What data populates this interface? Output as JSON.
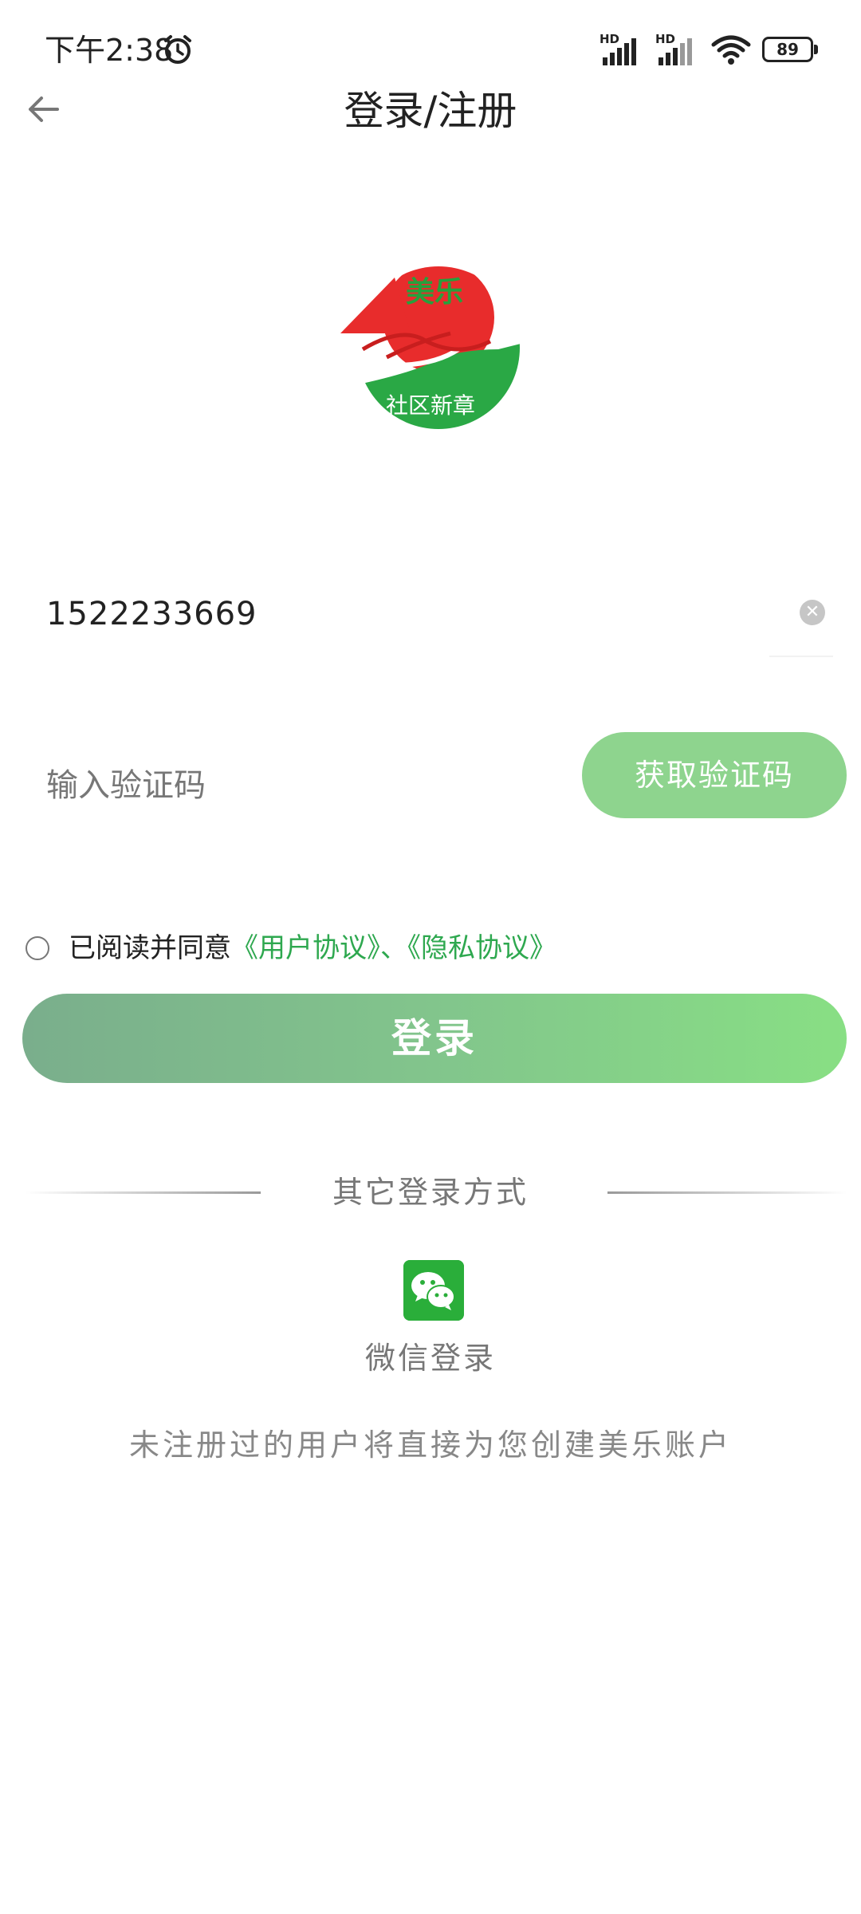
{
  "status_bar": {
    "time": "下午2:38",
    "signal_1_label": "HD",
    "signal_2_label": "HD",
    "battery": "89"
  },
  "header": {
    "title": "登录/注册"
  },
  "logo": {
    "text_top": "美乐",
    "text_bottom": "社区新章"
  },
  "form": {
    "phone_value": "1522233669",
    "code_placeholder": "输入验证码",
    "get_code_label": "获取验证码"
  },
  "agreement": {
    "prefix": "已阅读并同意",
    "user_agreement": "《用户协议》",
    "separator": "、",
    "privacy_agreement": "《隐私协议》"
  },
  "login_button": "登录",
  "other_login": {
    "title": "其它登录方式",
    "wechat_label": "微信登录"
  },
  "notice": "未注册过的用户将直接为您创建美乐账户",
  "colors": {
    "accent_green": "#2ea84f",
    "button_green": "#8ed48e",
    "wechat_green": "#2aae3a"
  }
}
